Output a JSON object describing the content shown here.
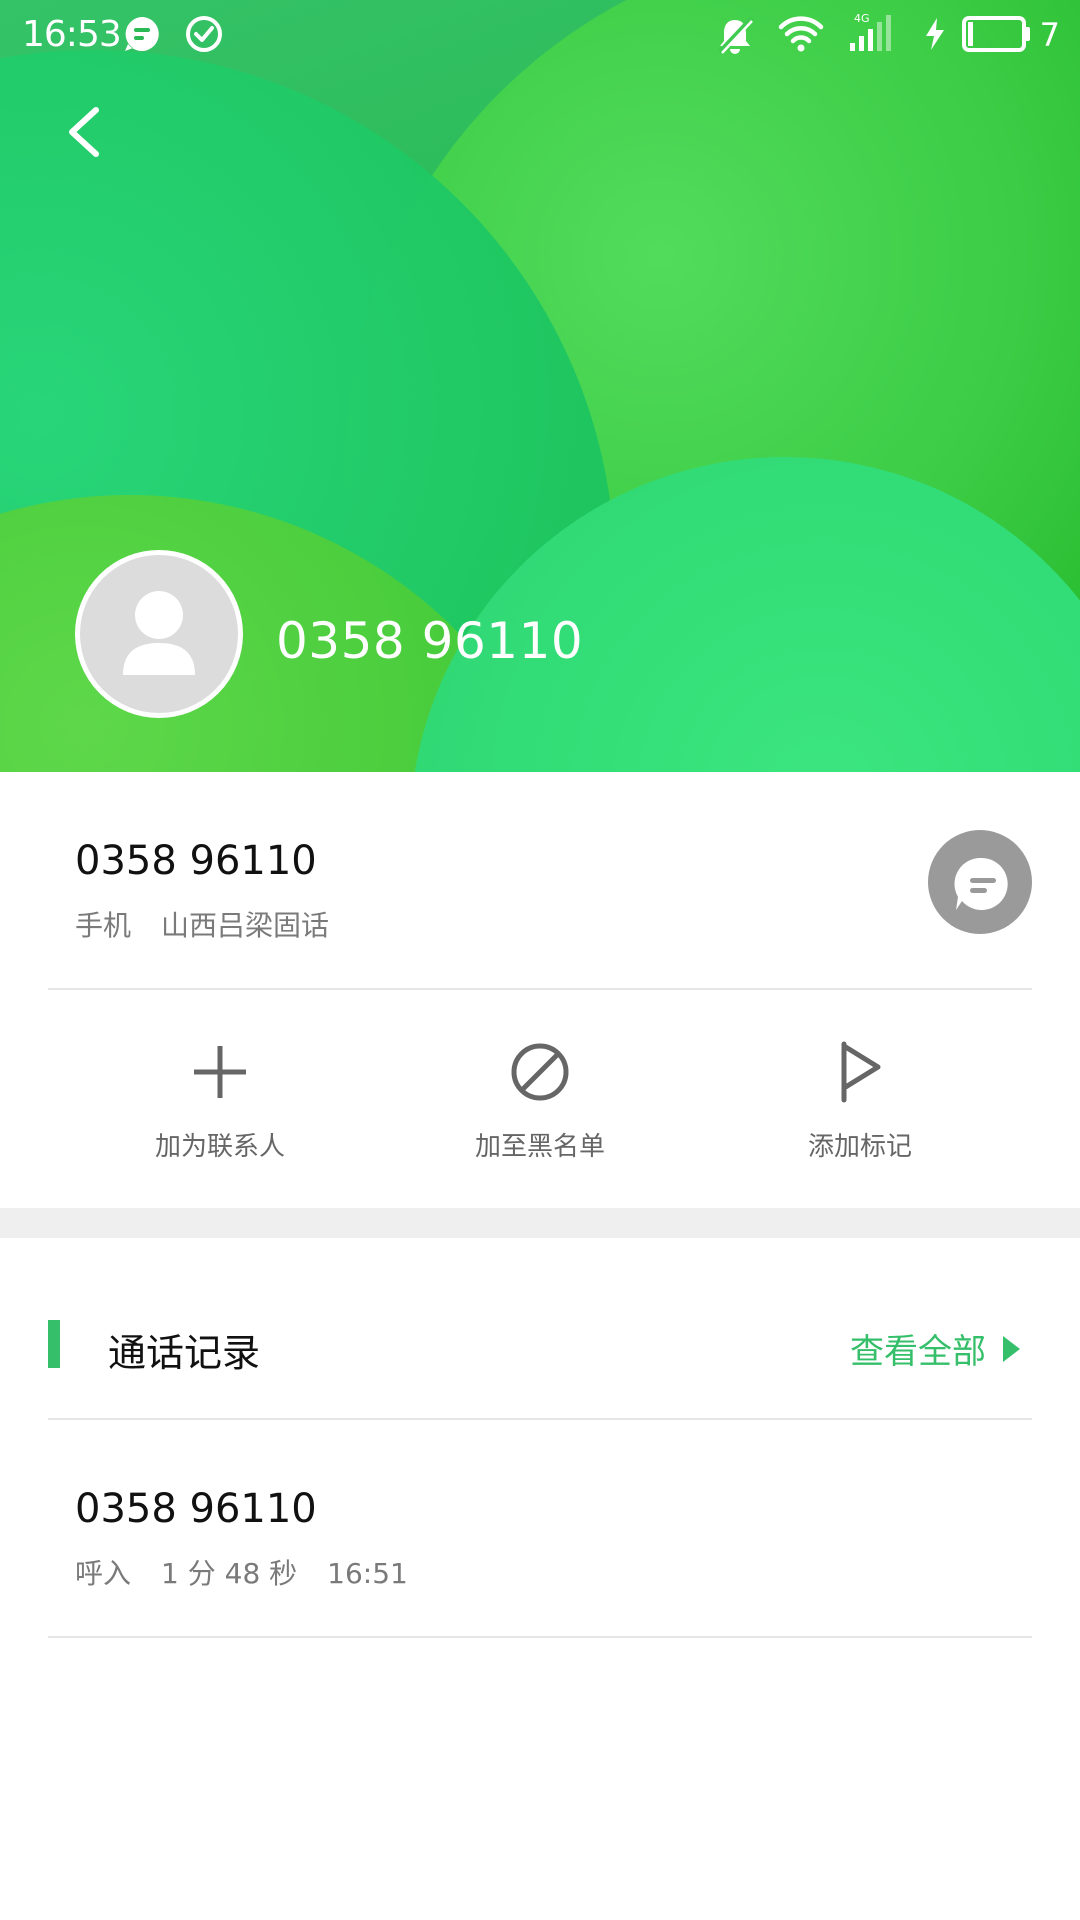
{
  "status_bar": {
    "time": "16:53",
    "battery_level": "7",
    "network": "4G",
    "icons": [
      "message-notification-icon",
      "check-circle-icon",
      "silent-bell-icon",
      "wifi-icon",
      "cellular-signal-icon",
      "charging-icon",
      "battery-icon"
    ]
  },
  "header": {
    "number": "0358 96110"
  },
  "number_row": {
    "number": "0358 96110",
    "type": "手机",
    "location": "山西吕梁固话"
  },
  "actions": [
    {
      "label": "加为联系人",
      "icon": "plus-icon"
    },
    {
      "label": "加至黑名单",
      "icon": "block-icon"
    },
    {
      "label": "添加标记",
      "icon": "flag-icon"
    }
  ],
  "call_log": {
    "title": "通话记录",
    "view_all": "查看全部",
    "entries": [
      {
        "number": "0358 96110",
        "direction": "呼入",
        "duration": "1 分 48 秒",
        "time": "16:51"
      }
    ]
  },
  "colors": {
    "accent": "#35bf6a",
    "header_green": "#2ab955",
    "message_button": "#9a9a9a"
  }
}
